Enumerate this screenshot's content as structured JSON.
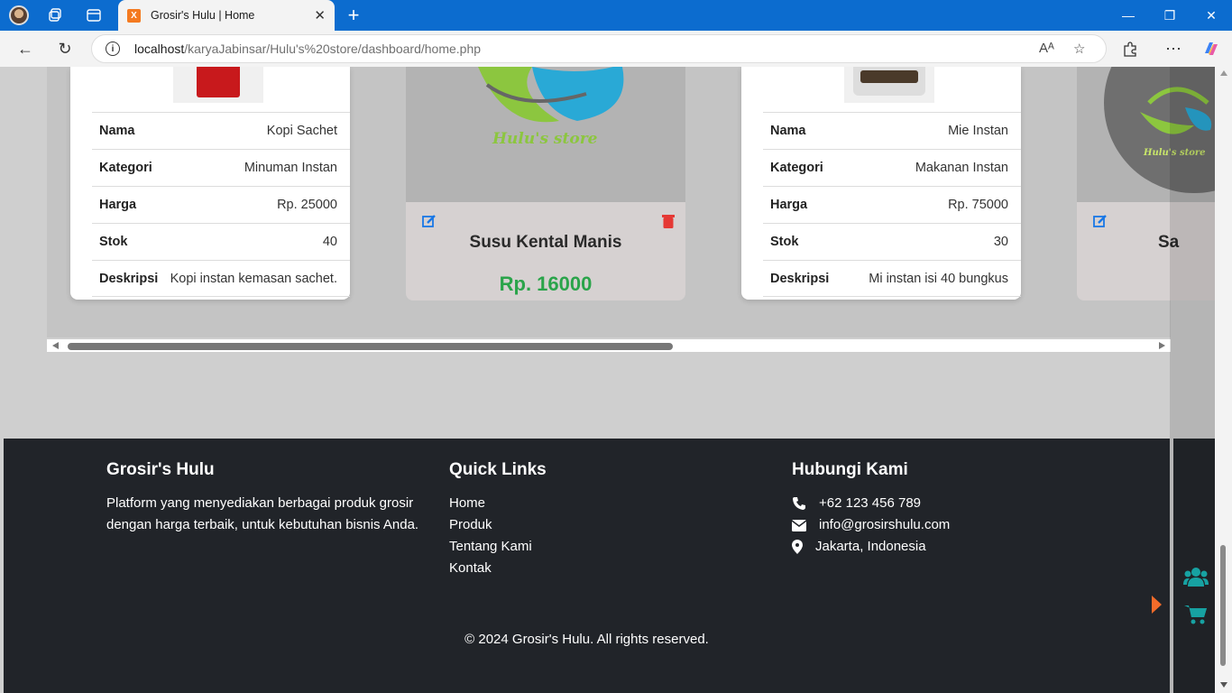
{
  "browser": {
    "tab_title": "Grosir's Hulu | Home",
    "tab_favicon_text": "X",
    "url_host": "localhost",
    "url_path": "/karyaJabinsar/Hulu's%20store/dashboard/home.php",
    "read_aloud_label": "Aᴬ"
  },
  "products": {
    "card1": {
      "rows": [
        {
          "key": "Nama",
          "value": "Kopi Sachet"
        },
        {
          "key": "Kategori",
          "value": "Minuman Instan"
        },
        {
          "key": "Harga",
          "value": "Rp. 25000"
        },
        {
          "key": "Stok",
          "value": "40"
        },
        {
          "key": "Deskripsi",
          "value": "Kopi instan kemasan sachet."
        }
      ]
    },
    "card2": {
      "logo_text": "Hulu's store",
      "name": "Susu Kental Manis",
      "price": "Rp. 16000"
    },
    "card3": {
      "rows": [
        {
          "key": "Nama",
          "value": "Mie Instan"
        },
        {
          "key": "Kategori",
          "value": "Makanan Instan"
        },
        {
          "key": "Harga",
          "value": "Rp. 75000"
        },
        {
          "key": "Stok",
          "value": "30"
        },
        {
          "key": "Deskripsi",
          "value": "Mi instan isi 40 bungkus"
        }
      ]
    },
    "card4": {
      "logo_text": "Hulu's store",
      "name_partial": "Sa"
    }
  },
  "footer": {
    "about": {
      "title": "Grosir's Hulu",
      "text": "Platform yang menyediakan berbagai produk grosir dengan harga terbaik, untuk kebutuhan bisnis Anda."
    },
    "links": {
      "title": "Quick Links",
      "items": [
        "Home",
        "Produk",
        "Tentang Kami",
        "Kontak"
      ]
    },
    "contact": {
      "title": "Hubungi Kami",
      "phone": "+62 123 456 789",
      "email": "info@grosirshulu.com",
      "location": "Jakarta, Indonesia"
    },
    "copyright": "© 2024 Grosir's Hulu. All rights reserved."
  },
  "colors": {
    "accent_green": "#2aa44a",
    "edit_blue": "#1877e6",
    "delete_red": "#e53935",
    "dock_teal": "#17a2a2",
    "toggle_orange": "#f26b2a"
  }
}
